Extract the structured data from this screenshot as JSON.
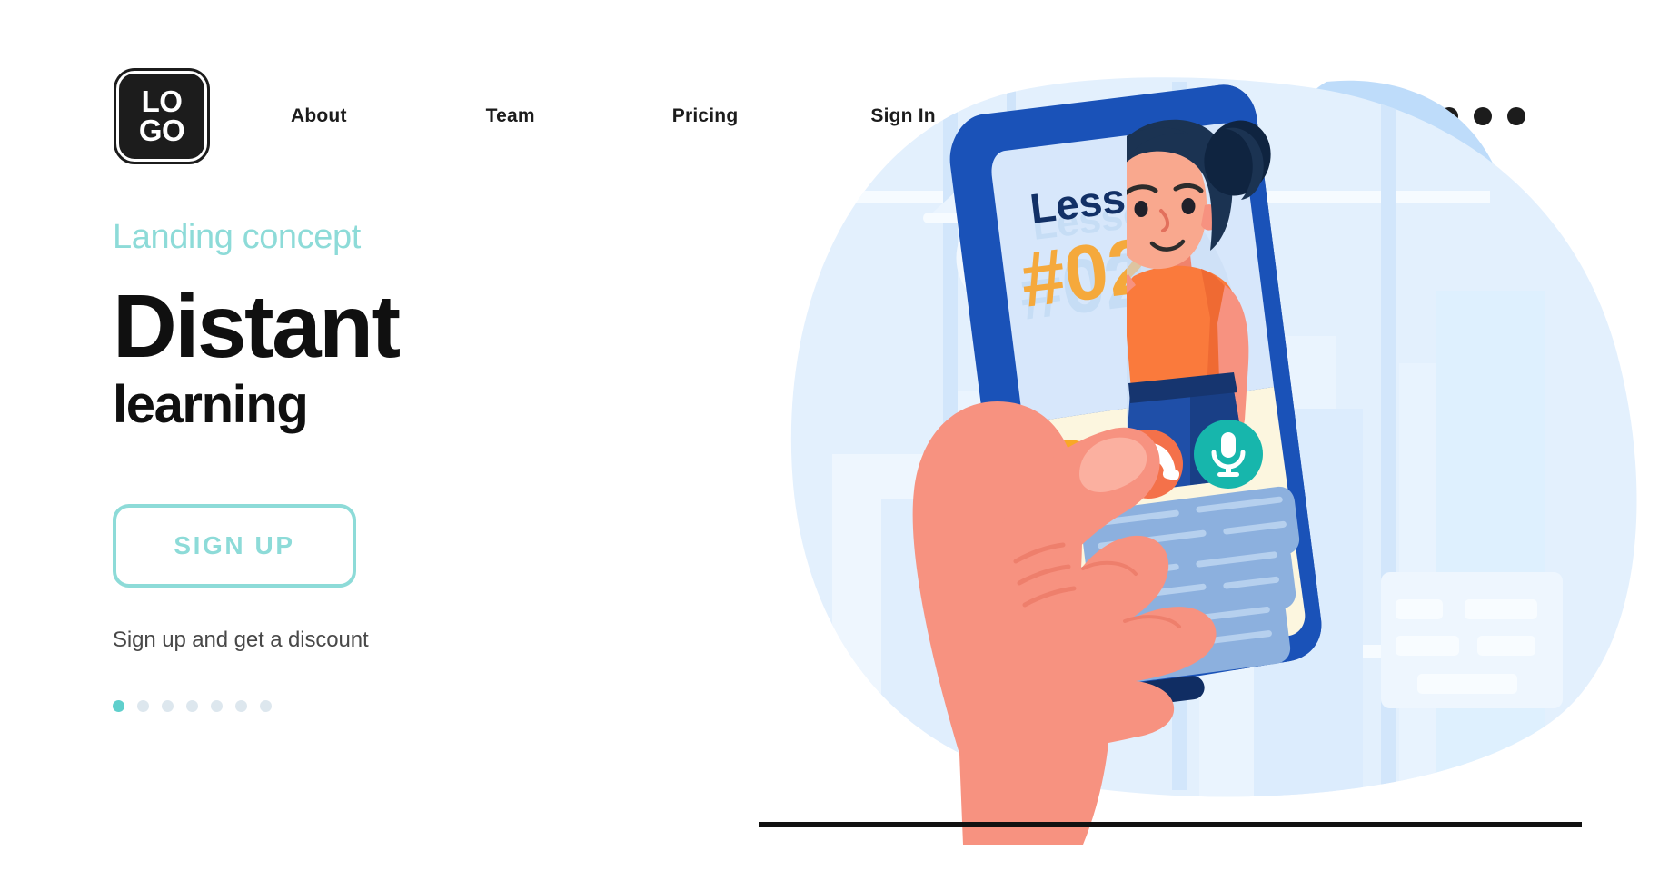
{
  "header": {
    "logo": {
      "line1": "LO",
      "line2": "GO",
      "name": "logo"
    },
    "nav": [
      {
        "label": "About"
      },
      {
        "label": "Team"
      },
      {
        "label": "Pricing"
      },
      {
        "label": "Sign In"
      }
    ],
    "menu_icon": "more-horizontal-icon"
  },
  "hero": {
    "eyebrow": "Landing concept",
    "title": "Distant",
    "subtitle": "learning",
    "cta_label": "SIGN UP",
    "note": "Sign up and get a discount",
    "carousel": {
      "total": 7,
      "active_index": 0
    }
  },
  "illustration": {
    "name": "hand-holding-phone-video-lesson",
    "phone": {
      "screen_title": "Lesson",
      "screen_number": "#02",
      "call_buttons": [
        {
          "name": "chat-bubble-icon",
          "color": "#f9a826"
        },
        {
          "name": "end-call-icon",
          "color": "#f4714a"
        },
        {
          "name": "microphone-icon",
          "color": "#17b6ac"
        }
      ],
      "chat_bubbles": 3
    },
    "teacher": {
      "name": "teacher-avatar"
    }
  },
  "colors": {
    "accent_teal": "#8ddbd8",
    "dot_active": "#5fcfcc",
    "ink": "#101010",
    "note_gray": "#484848",
    "phone_frame": "#1a52b8",
    "phone_frame_dark": "#143d91",
    "screen_blue": "#d7e7fb",
    "screen_cream": "#fcf6df",
    "blob_blue": "#e3f0fd",
    "blob_accent": "#bedcfa",
    "skin": "#f79280",
    "hair": "#1b3352",
    "shirt": "#fa7a3c",
    "pants": "#1f4fa8",
    "orange_number": "#f5a93c",
    "bubble_blue": "#8cb0de"
  }
}
